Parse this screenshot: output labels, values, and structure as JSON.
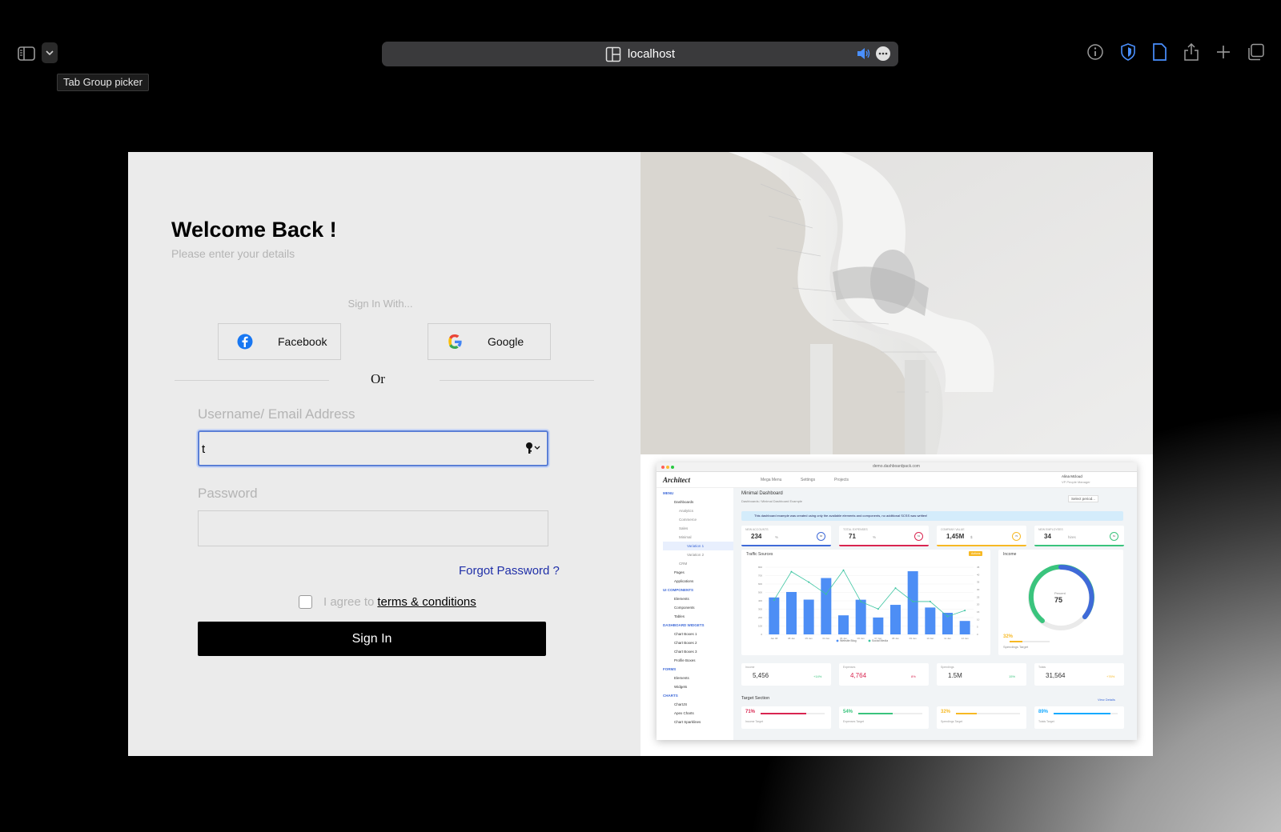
{
  "browser": {
    "tooltip": "Tab Group picker",
    "address": "localhost"
  },
  "login": {
    "title": "Welcome Back !",
    "subtitle": "Please enter your details",
    "sign_in_with": "Sign In With...",
    "facebook_label": "Facebook",
    "google_label": "Google",
    "or_text": "Or",
    "username_label": "Username/ Email Address",
    "username_value": "t",
    "password_label": "Password",
    "password_value": "",
    "forgot_password": "Forgot Password ?",
    "agree_prefix": "I agree to",
    "terms_link": "terms & conditions",
    "sign_in_button": "Sign In"
  },
  "dashboard_preview": {
    "brand": "Architect",
    "url": "demo.dashboardpack.com",
    "page_title": "Minimal Dashboard",
    "breadcrumb": "Dashboards  /  Minimal Dashboard Example",
    "alert": "This dashboard example was created using only the available elements and components, no additional SCSS was written!",
    "select_period": "Select period...",
    "user_name": "Alina Mcloud",
    "user_role": "VP People Manager",
    "top_menu": [
      "Mega Menu",
      "Settings",
      "Projects"
    ],
    "sidebar": {
      "menu_heading": "MENU",
      "items": [
        "Dashboards",
        "Analytics",
        "Commerce",
        "Sales",
        "Minimal",
        "Variation 1",
        "Variation 2",
        "CRM",
        "Pages",
        "Applications"
      ],
      "ui_heading": "UI COMPONENTS",
      "ui_items": [
        "Elements",
        "Components",
        "Tables"
      ],
      "widgets_heading": "DASHBOARD WIDGETS",
      "widget_items": [
        "Chart Boxes 1",
        "Chart Boxes 2",
        "Chart Boxes 3",
        "Profile Boxes"
      ],
      "forms_heading": "FORMS",
      "form_items": [
        "Elements",
        "Widgets"
      ],
      "charts_heading": "CHARTS",
      "chart_items": [
        "ChartJS",
        "Apex Charts",
        "Chart Sparklines"
      ]
    },
    "stats": [
      {
        "label": "NEW ACCOUNTS",
        "value": "234",
        "unit": "%",
        "ring": "68",
        "color": "#3f6ad8"
      },
      {
        "label": "TOTAL EXPENSES",
        "value": "71",
        "unit": "%",
        "ring": "63",
        "color": "#d92550"
      },
      {
        "label": "COMPANY VALUE",
        "value": "1,45M",
        "unit": "$",
        "ring": "79",
        "color": "#f7b924"
      },
      {
        "label": "NEW EMPLOYEES",
        "value": "34",
        "unit": "hires",
        "ring": "81",
        "color": "#3ac47d"
      }
    ],
    "traffic_title": "Traffic Sources",
    "traffic_badge": "Actions",
    "traffic_legend": [
      "Website Blog",
      "Social Media"
    ],
    "traffic_x": [
      "Jan 98",
      "08 Jan",
      "05 Jan",
      "04 Jan",
      "05 Jan",
      "06 Jan",
      "07 Jan",
      "08 Jan",
      "09 Jan",
      "10 Jan",
      "11 Jan",
      "12 Jan"
    ],
    "traffic_y_left": [
      "800",
      "700",
      "600",
      "500",
      "400",
      "300",
      "200",
      "100",
      "0"
    ],
    "traffic_y_right": [
      "45",
      "40",
      "35",
      "30",
      "25",
      "20",
      "15",
      "10",
      "5",
      "0"
    ],
    "traffic_bars": [
      440,
      505,
      414,
      671,
      227,
      413,
      201,
      352,
      752,
      320,
      257,
      160
    ],
    "traffic_line": [
      23,
      42,
      35,
      27,
      43,
      22,
      17,
      31,
      22,
      22,
      12,
      16
    ],
    "income_title": "Income",
    "income_percent_label": "Percent",
    "income_percent": "75",
    "income_target_pct": "32%",
    "income_target_label": "Spendings Target",
    "totals": [
      {
        "label": "Income",
        "value": "5,456",
        "change": "+14%",
        "color": "#3ac47d"
      },
      {
        "label": "Expenses",
        "value": "4,764",
        "change": "8%",
        "color": "#d92550"
      },
      {
        "label": "Spendings",
        "value": "1.5M",
        "change": "15%",
        "color": "#3ac47d"
      },
      {
        "label": "Totals",
        "value": "31,564",
        "change": "+76%",
        "color": "#f7b924"
      }
    ],
    "target_title": "Target Section",
    "view_details": "View Details",
    "targets": [
      {
        "pct": "71%",
        "label": "Income Target",
        "color": "#d92550",
        "fill": 0.71
      },
      {
        "pct": "54%",
        "label": "Expenses Target",
        "color": "#3ac47d",
        "fill": 0.54
      },
      {
        "pct": "32%",
        "label": "Spendings Target",
        "color": "#f7b924",
        "fill": 0.32
      },
      {
        "pct": "89%",
        "label": "Totals Target",
        "color": "#16aaff",
        "fill": 0.89
      }
    ]
  }
}
